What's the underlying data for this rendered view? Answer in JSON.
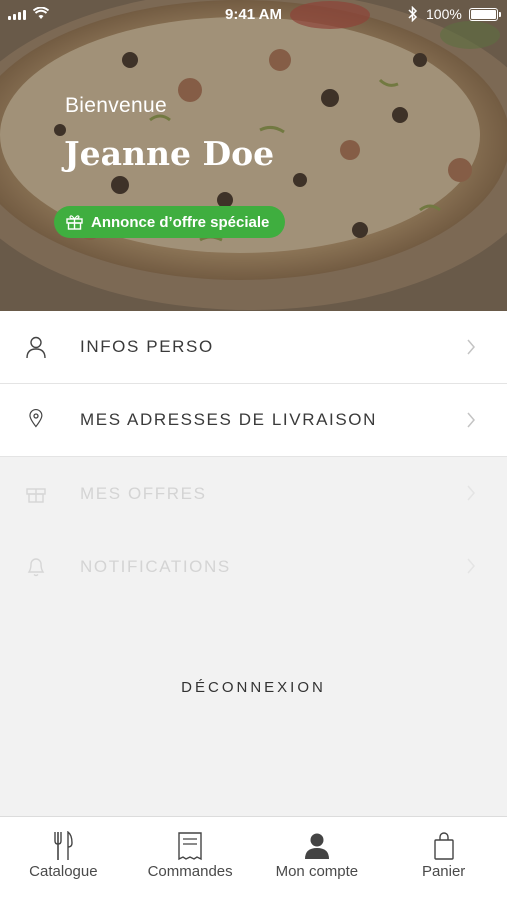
{
  "status_bar": {
    "time": "9:41 AM",
    "battery": "100%"
  },
  "hero": {
    "welcome": "Bienvenue",
    "username": "Jeanne Doe",
    "offer_label": "Annonce d’offre spéciale"
  },
  "menu": {
    "items": [
      {
        "label": "INFOS PERSO",
        "icon": "user-icon",
        "enabled": true
      },
      {
        "label": "MES ADRESSES DE LIVRAISON",
        "icon": "location-pin-icon",
        "enabled": true
      },
      {
        "label": "MES OFFRES",
        "icon": "gift-icon",
        "enabled": false
      },
      {
        "label": "NOTIFICATIONS",
        "icon": "bell-icon",
        "enabled": false
      }
    ]
  },
  "logout_label": "DÉCONNEXION",
  "tabbar": {
    "items": [
      {
        "label": "Catalogue",
        "icon": "fork-knife-icon"
      },
      {
        "label": "Commandes",
        "icon": "receipt-icon"
      },
      {
        "label": "Mon compte",
        "icon": "user-filled-icon",
        "selected": true
      },
      {
        "label": "Panier",
        "icon": "bag-icon"
      }
    ]
  },
  "colors": {
    "accent_green": "#3fae3f",
    "background": "#f2f2f2"
  }
}
